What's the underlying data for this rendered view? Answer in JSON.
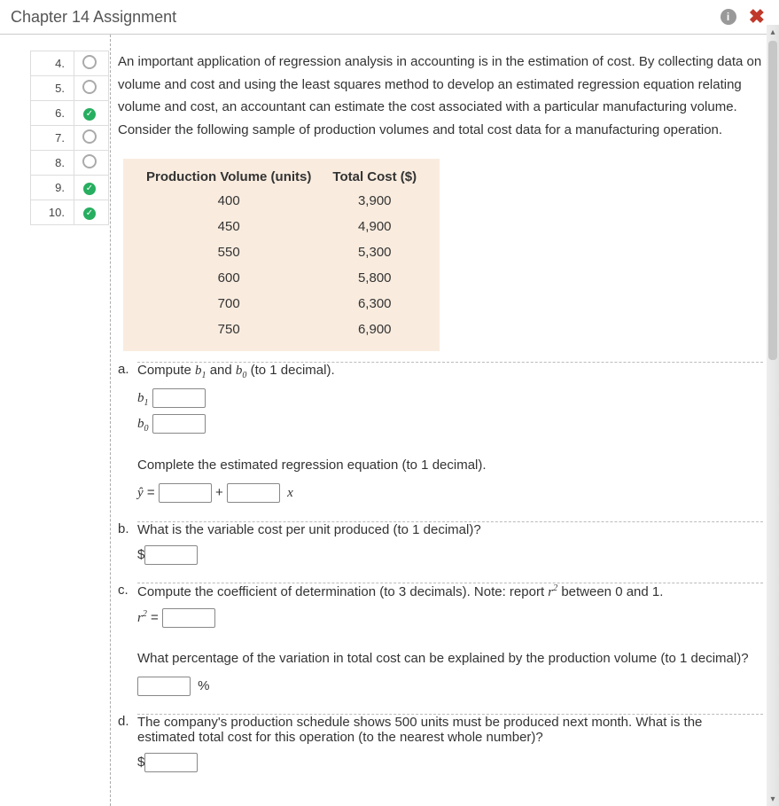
{
  "header": {
    "title": "Chapter 14 Assignment"
  },
  "sidebar": {
    "items": [
      {
        "num": "4.",
        "status": "blank"
      },
      {
        "num": "5.",
        "status": "blank"
      },
      {
        "num": "6.",
        "status": "check"
      },
      {
        "num": "7.",
        "status": "blank"
      },
      {
        "num": "8.",
        "status": "blank"
      },
      {
        "num": "9.",
        "status": "check"
      },
      {
        "num": "10.",
        "status": "check"
      }
    ]
  },
  "intro": "An important application of regression analysis in accounting is in the estimation of cost. By collecting data on volume and cost and using the least squares method to develop an estimated regression equation relating volume and cost, an accountant can estimate the cost associated with a particular manufacturing volume. Consider the following sample of production volumes and total cost data for a manufacturing operation.",
  "table": {
    "head1": "Production Volume (units)",
    "head2": "Total Cost ($)",
    "rows": [
      {
        "vol": "400",
        "cost": "3,900"
      },
      {
        "vol": "450",
        "cost": "4,900"
      },
      {
        "vol": "550",
        "cost": "5,300"
      },
      {
        "vol": "600",
        "cost": "5,800"
      },
      {
        "vol": "700",
        "cost": "6,300"
      },
      {
        "vol": "750",
        "cost": "6,900"
      }
    ]
  },
  "q": {
    "a1": "Compute ",
    "a1_end": " (to 1 decimal).",
    "a1_lbl_b1": "b",
    "a1_lbl_b1_sub": "1",
    "a1_lbl_b0": "b",
    "a1_lbl_b0_sub": "0",
    "a1_and": " and ",
    "a2": "Complete the estimated regression equation (to 1 decimal).",
    "a2_yhat": "ŷ",
    "a2_eq": " = ",
    "a2_plus": " + ",
    "a2_x": "x",
    "b": "What is the variable cost per unit produced (to 1 decimal)?",
    "b_dollar": "$",
    "c1_pre": "Compute the coefficient of determination (to 3 decimals). Note: report ",
    "c1_r2": "r",
    "c1_sup": "2",
    "c1_post": " between 0 and 1.",
    "c1_lbl": "r",
    "c1_lbl_eq": " = ",
    "c2": "What percentage of the variation in total cost can be explained by the production volume (to 1 decimal)?",
    "c2_pct": "%",
    "d": "The company's production schedule shows 500 units must be produced next month. What is the estimated total cost for this operation (to the nearest whole number)?",
    "d_dollar": "$",
    "letters": {
      "a": "a.",
      "b": "b.",
      "c": "c.",
      "d": "d."
    }
  }
}
